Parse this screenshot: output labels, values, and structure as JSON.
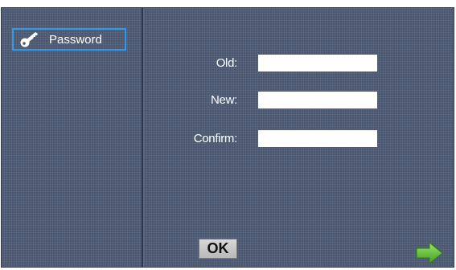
{
  "sidebar": {
    "items": [
      {
        "label": "Password",
        "icon": "key-icon",
        "selected": true
      }
    ]
  },
  "form": {
    "old_label": "Old:",
    "old_value": "",
    "new_label": "New:",
    "new_value": "",
    "confirm_label": "Confirm:",
    "confirm_value": ""
  },
  "footer": {
    "ok_label": "OK",
    "next_icon": "arrow-right-icon"
  },
  "colors": {
    "background": "#4a5770",
    "selection_border": "#2f9be8",
    "arrow": "#5cc233"
  }
}
